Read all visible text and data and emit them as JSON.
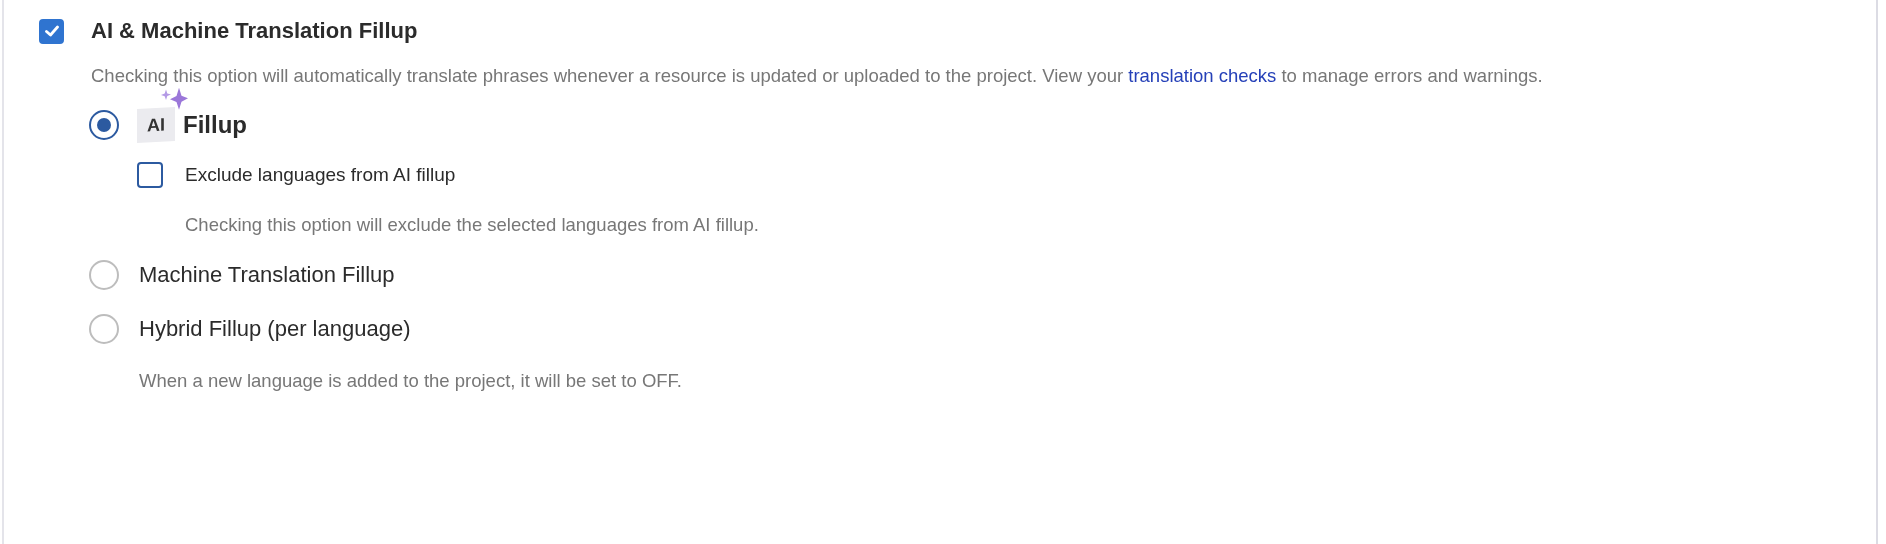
{
  "setting": {
    "label": "AI & Machine Translation Fillup",
    "checked": true,
    "description": {
      "before": "Checking this option will automatically translate phrases whenever a resource is updated or uploaded to the project. View your ",
      "link": "translation checks",
      "after": " to manage errors and warnings."
    },
    "options": [
      {
        "kind": "ai",
        "badge": "AI",
        "label": "Fillup",
        "selected": true,
        "suboption": {
          "label": "Exclude languages from AI fillup",
          "checked": false,
          "hint": "Checking this option will exclude the selected languages from AI fillup."
        }
      },
      {
        "kind": "plain",
        "label": "Machine Translation Fillup",
        "selected": false
      },
      {
        "kind": "plain",
        "label": "Hybrid Fillup (per language)",
        "selected": false,
        "hint": "When a new language is added to the project, it will be set to OFF."
      }
    ]
  }
}
